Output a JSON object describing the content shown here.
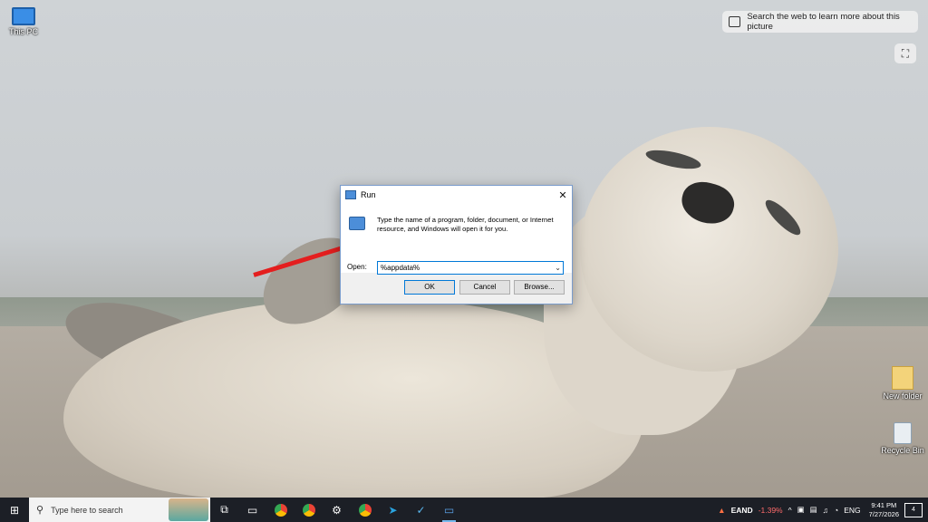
{
  "desktop": {
    "icons": [
      {
        "label": "This PC"
      },
      {
        "label": "New folder"
      },
      {
        "label": "Recycle Bin"
      }
    ]
  },
  "lens": {
    "prompt": "Search the web to learn more about this picture",
    "scan_glyph": "⛶"
  },
  "run_dialog": {
    "title": "Run",
    "close_glyph": "✕",
    "description": "Type the name of a program, folder, document, or Internet resource, and Windows will open it for you.",
    "open_label": "Open:",
    "open_value": "%appdata%",
    "ok_label": "OK",
    "cancel_label": "Cancel",
    "browse_label": "Browse...",
    "chevron_glyph": "⌄"
  },
  "taskbar": {
    "start_glyph": "⊞",
    "search_placeholder": "Type here to search",
    "search_glyph": "⚲",
    "apps": [
      {
        "name": "task-view",
        "glyph": "⧉"
      },
      {
        "name": "file-explorer",
        "glyph": "▭"
      },
      {
        "name": "chrome",
        "glyph": ""
      },
      {
        "name": "chrome-2",
        "glyph": ""
      },
      {
        "name": "settings",
        "glyph": "⚙"
      },
      {
        "name": "chrome-3",
        "glyph": ""
      },
      {
        "name": "telegram",
        "glyph": "➤"
      },
      {
        "name": "app-v",
        "glyph": "✓"
      },
      {
        "name": "run",
        "glyph": "▭"
      }
    ],
    "ticker": {
      "name": "EAND",
      "change": "-1.39%"
    },
    "tray_glyphs": [
      "^",
      "▣",
      "▤",
      "♫",
      "◔",
      "ENG"
    ],
    "time": "9:41 PM",
    "date": "7/27/2026",
    "notification_count": "4"
  },
  "colors": {
    "arrow": "#e41e1e",
    "taskbar": "#1c1f26",
    "accent": "#0078d7"
  }
}
